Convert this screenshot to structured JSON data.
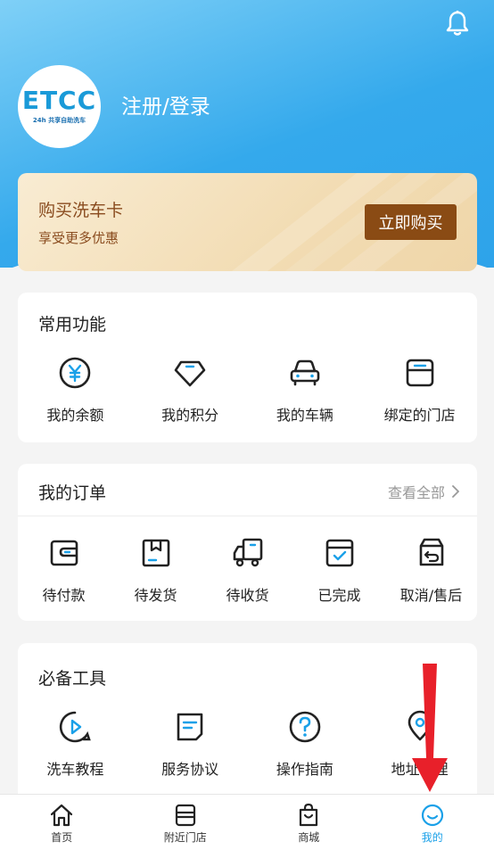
{
  "header": {
    "logo_main": "ETCC",
    "logo_sub": "24h 共享自助洗车",
    "login_text": "注册/登录"
  },
  "promo": {
    "title": "购买洗车卡",
    "subtitle": "享受更多优惠",
    "button": "立即购买"
  },
  "common": {
    "title": "常用功能",
    "items": [
      {
        "label": "我的余额",
        "icon": "yuan-icon"
      },
      {
        "label": "我的积分",
        "icon": "diamond-icon"
      },
      {
        "label": "我的车辆",
        "icon": "car-icon"
      },
      {
        "label": "绑定的门店",
        "icon": "store-icon"
      }
    ]
  },
  "orders": {
    "title": "我的订单",
    "view_all": "查看全部",
    "items": [
      {
        "label": "待付款",
        "icon": "wallet-icon"
      },
      {
        "label": "待发货",
        "icon": "box-icon"
      },
      {
        "label": "待收货",
        "icon": "truck-icon"
      },
      {
        "label": "已完成",
        "icon": "calendar-check-icon"
      },
      {
        "label": "取消/售后",
        "icon": "return-icon"
      }
    ]
  },
  "tools": {
    "title": "必备工具",
    "items": [
      {
        "label": "洗车教程",
        "icon": "play-tutorial-icon"
      },
      {
        "label": "服务协议",
        "icon": "document-icon"
      },
      {
        "label": "操作指南",
        "icon": "help-icon"
      },
      {
        "label": "地址管理",
        "icon": "location-icon"
      }
    ]
  },
  "tabbar": {
    "items": [
      {
        "label": "首页",
        "icon": "home-icon"
      },
      {
        "label": "附近门店",
        "icon": "nearby-store-icon"
      },
      {
        "label": "商城",
        "icon": "shopping-bag-icon"
      },
      {
        "label": "我的",
        "icon": "smile-icon"
      }
    ],
    "active_color": "#1aa0e8"
  },
  "colors": {
    "accent": "#2ea3ea",
    "promo_button": "#8a4b14",
    "annotation_arrow": "#e8202a"
  }
}
